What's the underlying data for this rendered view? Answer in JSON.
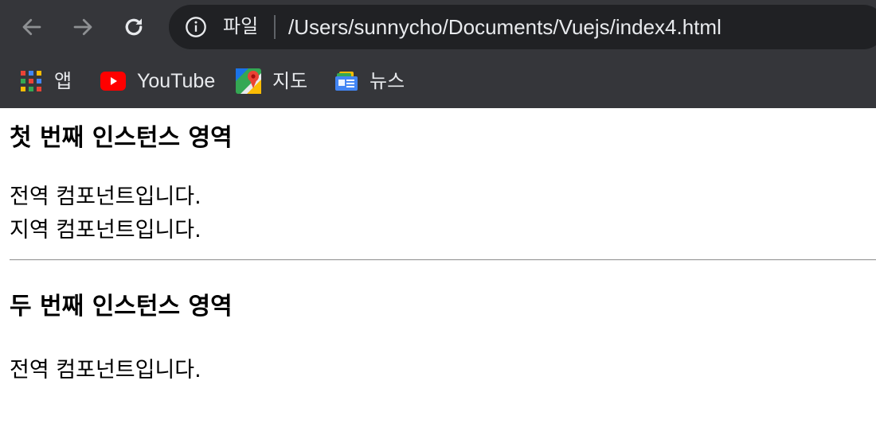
{
  "browser": {
    "omnibox": {
      "scheme_label": "파일",
      "url": "/Users/sunnycho/Documents/Vuejs/index4.html"
    },
    "bookmarks": [
      {
        "label": "앱",
        "icon": "apps-grid-icon"
      },
      {
        "label": "YouTube",
        "icon": "youtube-icon"
      },
      {
        "label": "지도",
        "icon": "maps-icon"
      },
      {
        "label": "뉴스",
        "icon": "news-icon"
      }
    ]
  },
  "page": {
    "first_instance": {
      "heading": "첫 번째 인스턴스 영역",
      "lines": [
        "전역 컴포넌트입니다.",
        "지역 컴포넌트입니다."
      ]
    },
    "second_instance": {
      "heading": "두 번째 인스턴스 영역",
      "lines": [
        "전역 컴포넌트입니다."
      ]
    }
  },
  "colors": {
    "chrome_bg": "#35363a",
    "omnibox_bg": "#202124",
    "chrome_text": "#e8eaed",
    "youtube_red": "#ff0000"
  }
}
